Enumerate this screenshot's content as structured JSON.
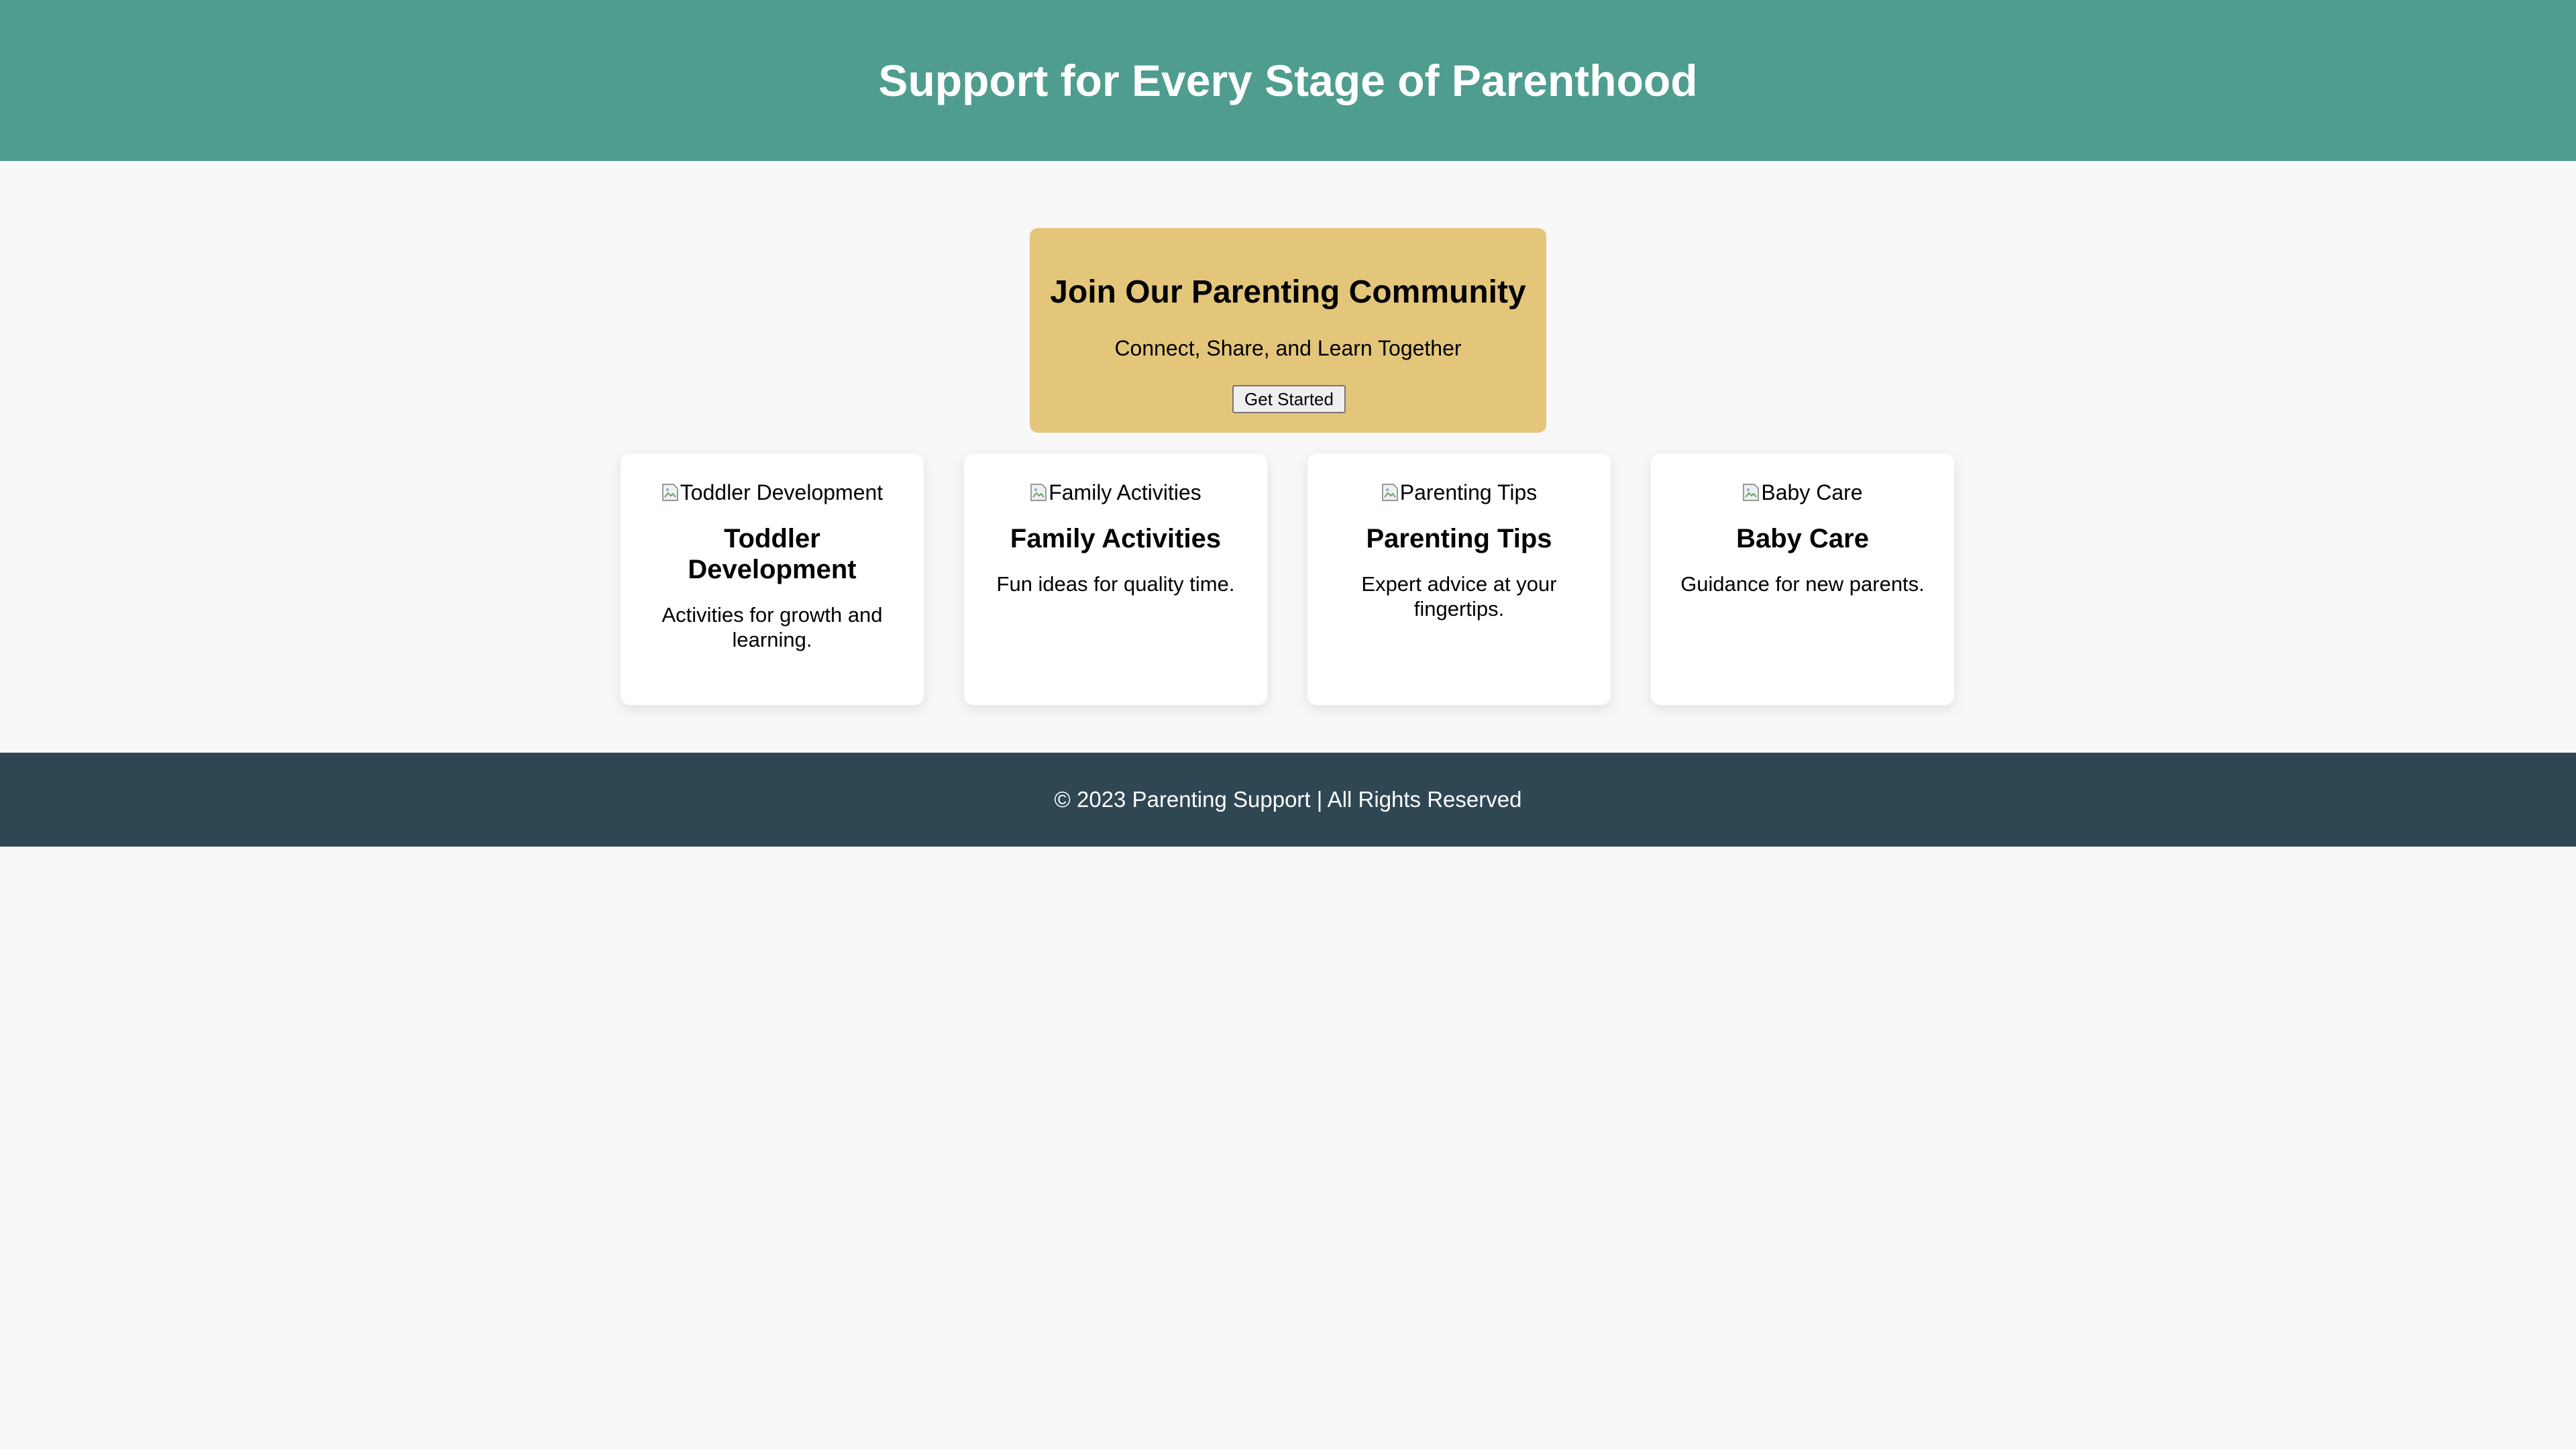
{
  "header": {
    "title": "Support for Every Stage of Parenthood"
  },
  "community": {
    "title": "Join Our Parenting Community",
    "subtitle": "Connect, Share, and Learn Together",
    "button_label": "Get Started"
  },
  "cards": [
    {
      "image_alt": "Toddler Development",
      "title": "Toddler Development",
      "description": "Activities for growth and learning."
    },
    {
      "image_alt": "Family Activities",
      "title": "Family Activities",
      "description": "Fun ideas for quality time."
    },
    {
      "image_alt": "Parenting Tips",
      "title": "Parenting Tips",
      "description": "Expert advice at your fingertips."
    },
    {
      "image_alt": "Baby Care",
      "title": "Baby Care",
      "description": "Guidance for new parents."
    }
  ],
  "footer": {
    "text": "© 2023 Parenting Support | All Rights Reserved"
  },
  "colors": {
    "header_bg": "#4f9d8f",
    "community_bg": "#e3c67a",
    "page_bg": "#f8f8f8",
    "card_bg": "#ffffff",
    "footer_bg": "#2e4753"
  },
  "icons": {
    "card_image_placeholder": "broken-image-icon"
  }
}
